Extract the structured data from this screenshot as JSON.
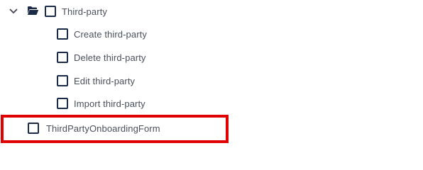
{
  "tree": {
    "parent": {
      "label": "Third-party",
      "expanded": true,
      "icons": {
        "expand": "chevron-down-icon",
        "folder": "folder-open-icon"
      }
    },
    "children": [
      {
        "label": "Create third-party",
        "checked": false
      },
      {
        "label": "Delete third-party",
        "checked": false
      },
      {
        "label": "Edit third-party",
        "checked": false
      },
      {
        "label": "Import third-party",
        "checked": false
      }
    ],
    "sibling": {
      "label": "ThirdPartyOnboardingForm",
      "checked": false
    }
  },
  "colors": {
    "checkbox_border": "#1b2a47",
    "text": "#4a4f5c",
    "highlight": "#e00000"
  }
}
